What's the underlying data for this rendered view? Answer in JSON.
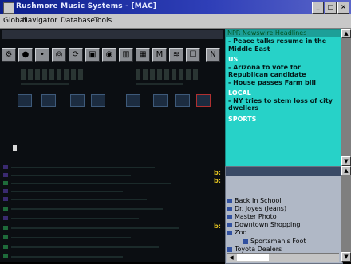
{
  "window": {
    "title": "Rushmore Music Systems - [MAC]",
    "min_label": "_",
    "max_label": "□",
    "close_label": "×"
  },
  "menu": [
    "Global",
    "Navigator",
    "Database",
    "Tools"
  ],
  "toolbar": {
    "buttons": [
      "⚙",
      "●",
      "•",
      "◎",
      "⟳",
      "▣",
      "◉",
      "▥",
      "▦",
      "M",
      "≋",
      "☐",
      "N"
    ]
  },
  "news": {
    "header": "NPR Newswire Headlines",
    "items": [
      {
        "type": "text",
        "text": "- Peace talks resume in the Middle East"
      },
      {
        "type": "section",
        "text": "US"
      },
      {
        "type": "text",
        "text": "- Arizona to vote for Republican candidate"
      },
      {
        "type": "text",
        "text": "- House passes Farm bill"
      },
      {
        "type": "section",
        "text": "LOCAL"
      },
      {
        "type": "text",
        "text": "- NY tries to stem loss of city dwellers"
      },
      {
        "type": "section",
        "text": "SPORTS"
      }
    ]
  },
  "tree": {
    "items": [
      "Back In School",
      "Dr. Joyes (Jeans)",
      "Master Photo",
      "Downtown Shopping",
      "Zoo",
      "Sportsman's Foot",
      "Toyota Dealers"
    ]
  },
  "list": {
    "markers": [
      "b:",
      "b:",
      "b:"
    ]
  },
  "colors": {
    "accent": "#27d2c8",
    "titlebar": "#0d1f8c"
  }
}
